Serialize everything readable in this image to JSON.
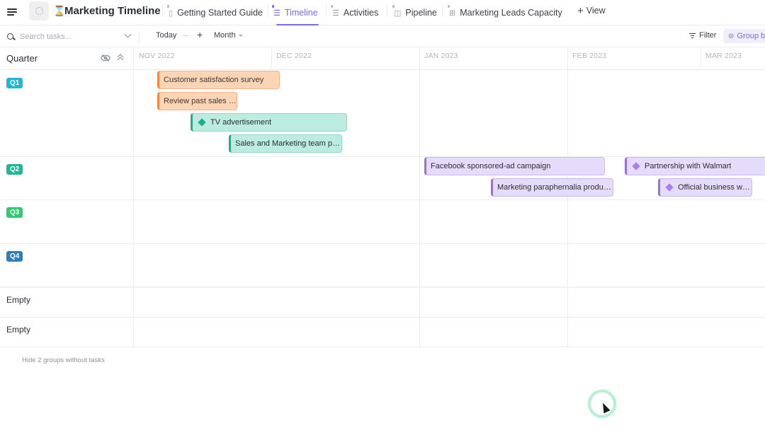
{
  "header": {
    "title": "Marketing Timeline",
    "title_icon": "hourglass-icon",
    "tabs": [
      {
        "label": "Getting Started Guide",
        "icon": "doc-icon",
        "active": false
      },
      {
        "label": "Timeline",
        "icon": "timeline-icon",
        "active": true
      },
      {
        "label": "Activities",
        "icon": "list-icon",
        "active": false
      },
      {
        "label": "Pipeline",
        "icon": "board-icon",
        "active": false
      },
      {
        "label": "Marketing Leads Capacity",
        "icon": "grid-icon",
        "active": false
      }
    ],
    "add_view_label": "View",
    "accent_color": "#7b68ee"
  },
  "toolbar": {
    "search_placeholder": "Search tasks...",
    "search_value": "",
    "today_label": "Today",
    "minus_label": "–",
    "plus_label": "+",
    "scale_label": "Month",
    "filter_label": "Filter",
    "groupby_label": "Group by"
  },
  "timeline": {
    "group_column_label": "Quarter",
    "months": [
      "NOV 2022",
      "DEC 2022",
      "JAN 2023",
      "FEB 2023",
      "MAR 2023"
    ],
    "groups": [
      {
        "label": "Q1",
        "color": "#1cb8d8"
      },
      {
        "label": "Q2",
        "color": "#1fb894"
      },
      {
        "label": "Q3",
        "color": "#2ecc71"
      },
      {
        "label": "Q4",
        "color": "#2f7fb6"
      },
      {
        "label": "Empty",
        "color": null
      },
      {
        "label": "Empty",
        "color": null
      }
    ],
    "tasks": [
      {
        "label": "Customer satisfaction survey",
        "group": "Q1",
        "color": "orange",
        "milestone": false
      },
      {
        "label": "Review past sales a...",
        "group": "Q1",
        "color": "orange",
        "milestone": false
      },
      {
        "label": "TV advertisement",
        "group": "Q1",
        "color": "teal",
        "milestone": true
      },
      {
        "label": "Sales and Marketing team pla...",
        "group": "Q1",
        "color": "teal",
        "milestone": false
      },
      {
        "label": "Facebook sponsored-ad campaign",
        "group": "Q2",
        "color": "purple",
        "milestone": false
      },
      {
        "label": "Partnership with Walmart",
        "group": "Q2",
        "color": "purple",
        "milestone": true
      },
      {
        "label": "Marketing paraphernalia product...",
        "group": "Q2",
        "color": "purple",
        "milestone": false
      },
      {
        "label": "Official business we...",
        "group": "Q2",
        "color": "purple",
        "milestone": true
      }
    ],
    "hide_groups_label": "Hide 2 groups without tasks"
  }
}
